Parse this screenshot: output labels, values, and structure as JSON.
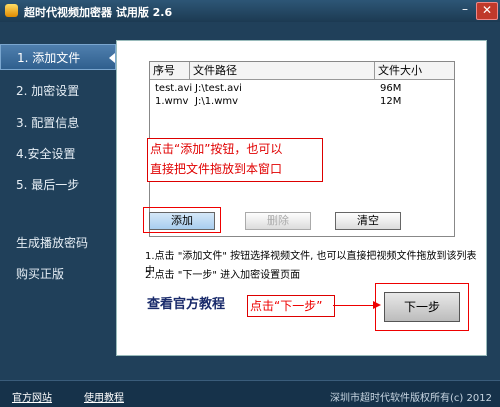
{
  "window": {
    "title": "超时代视频加密器 试用版 2.6",
    "minimize_label": "–",
    "close_label": "✕"
  },
  "sidebar": {
    "items": [
      {
        "label": "1. 添加文件"
      },
      {
        "label": "2. 加密设置"
      },
      {
        "label": "3. 配置信息"
      },
      {
        "label": "4.安全设置"
      },
      {
        "label": "5. 最后一步"
      },
      {
        "label": "生成播放密码"
      },
      {
        "label": "购买正版"
      }
    ]
  },
  "file_table": {
    "headers": [
      "序号",
      "文件路径",
      "文件大小"
    ],
    "rows": [
      [
        "test.avi",
        "J:\\test.avi",
        "96M"
      ],
      [
        "1.wmv",
        "J:\\1.wmv",
        "12M"
      ]
    ]
  },
  "note_text_line1": "点击“添加”按钮，也可以",
  "note_text_line2": "直接把文件拖放到本窗口",
  "buttons": {
    "add": "添加",
    "delete": "删除",
    "clear": "清空",
    "next": "下一步"
  },
  "instructions": {
    "line1": "1.点击 \"添加文件\" 按钮选择视频文件, 也可以直接把视频文件拖放到该列表中",
    "line2": "2.点击 \"下一步\" 进入加密设置页面"
  },
  "tutorial_link": "查看官方教程",
  "callout_text": "点击“下一步”",
  "footer": {
    "official_site": "官方网站",
    "usage_tutorial": "使用教程",
    "copyright": "深圳市超时代软件版权所有(c) 2012"
  }
}
